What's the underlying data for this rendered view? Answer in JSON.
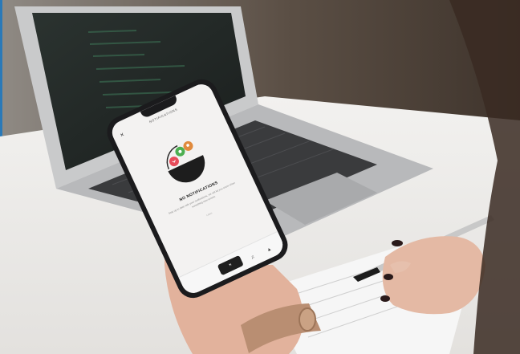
{
  "phone": {
    "screen_title": "NOTIFICATIONS",
    "close_glyph": "×",
    "empty_title": "NO NOTIFICATIONS",
    "empty_description": "Stay up to date with your notifications, we will let you know when something new arrives",
    "link": "Learn",
    "tab_icons": [
      "close-icon",
      "bell-icon",
      "user-icon"
    ],
    "tab_glyphs": [
      "×",
      "♫",
      "▲"
    ],
    "badge_colors": [
      "#e74c5a",
      "#4caf50",
      "#e08a3c"
    ]
  }
}
